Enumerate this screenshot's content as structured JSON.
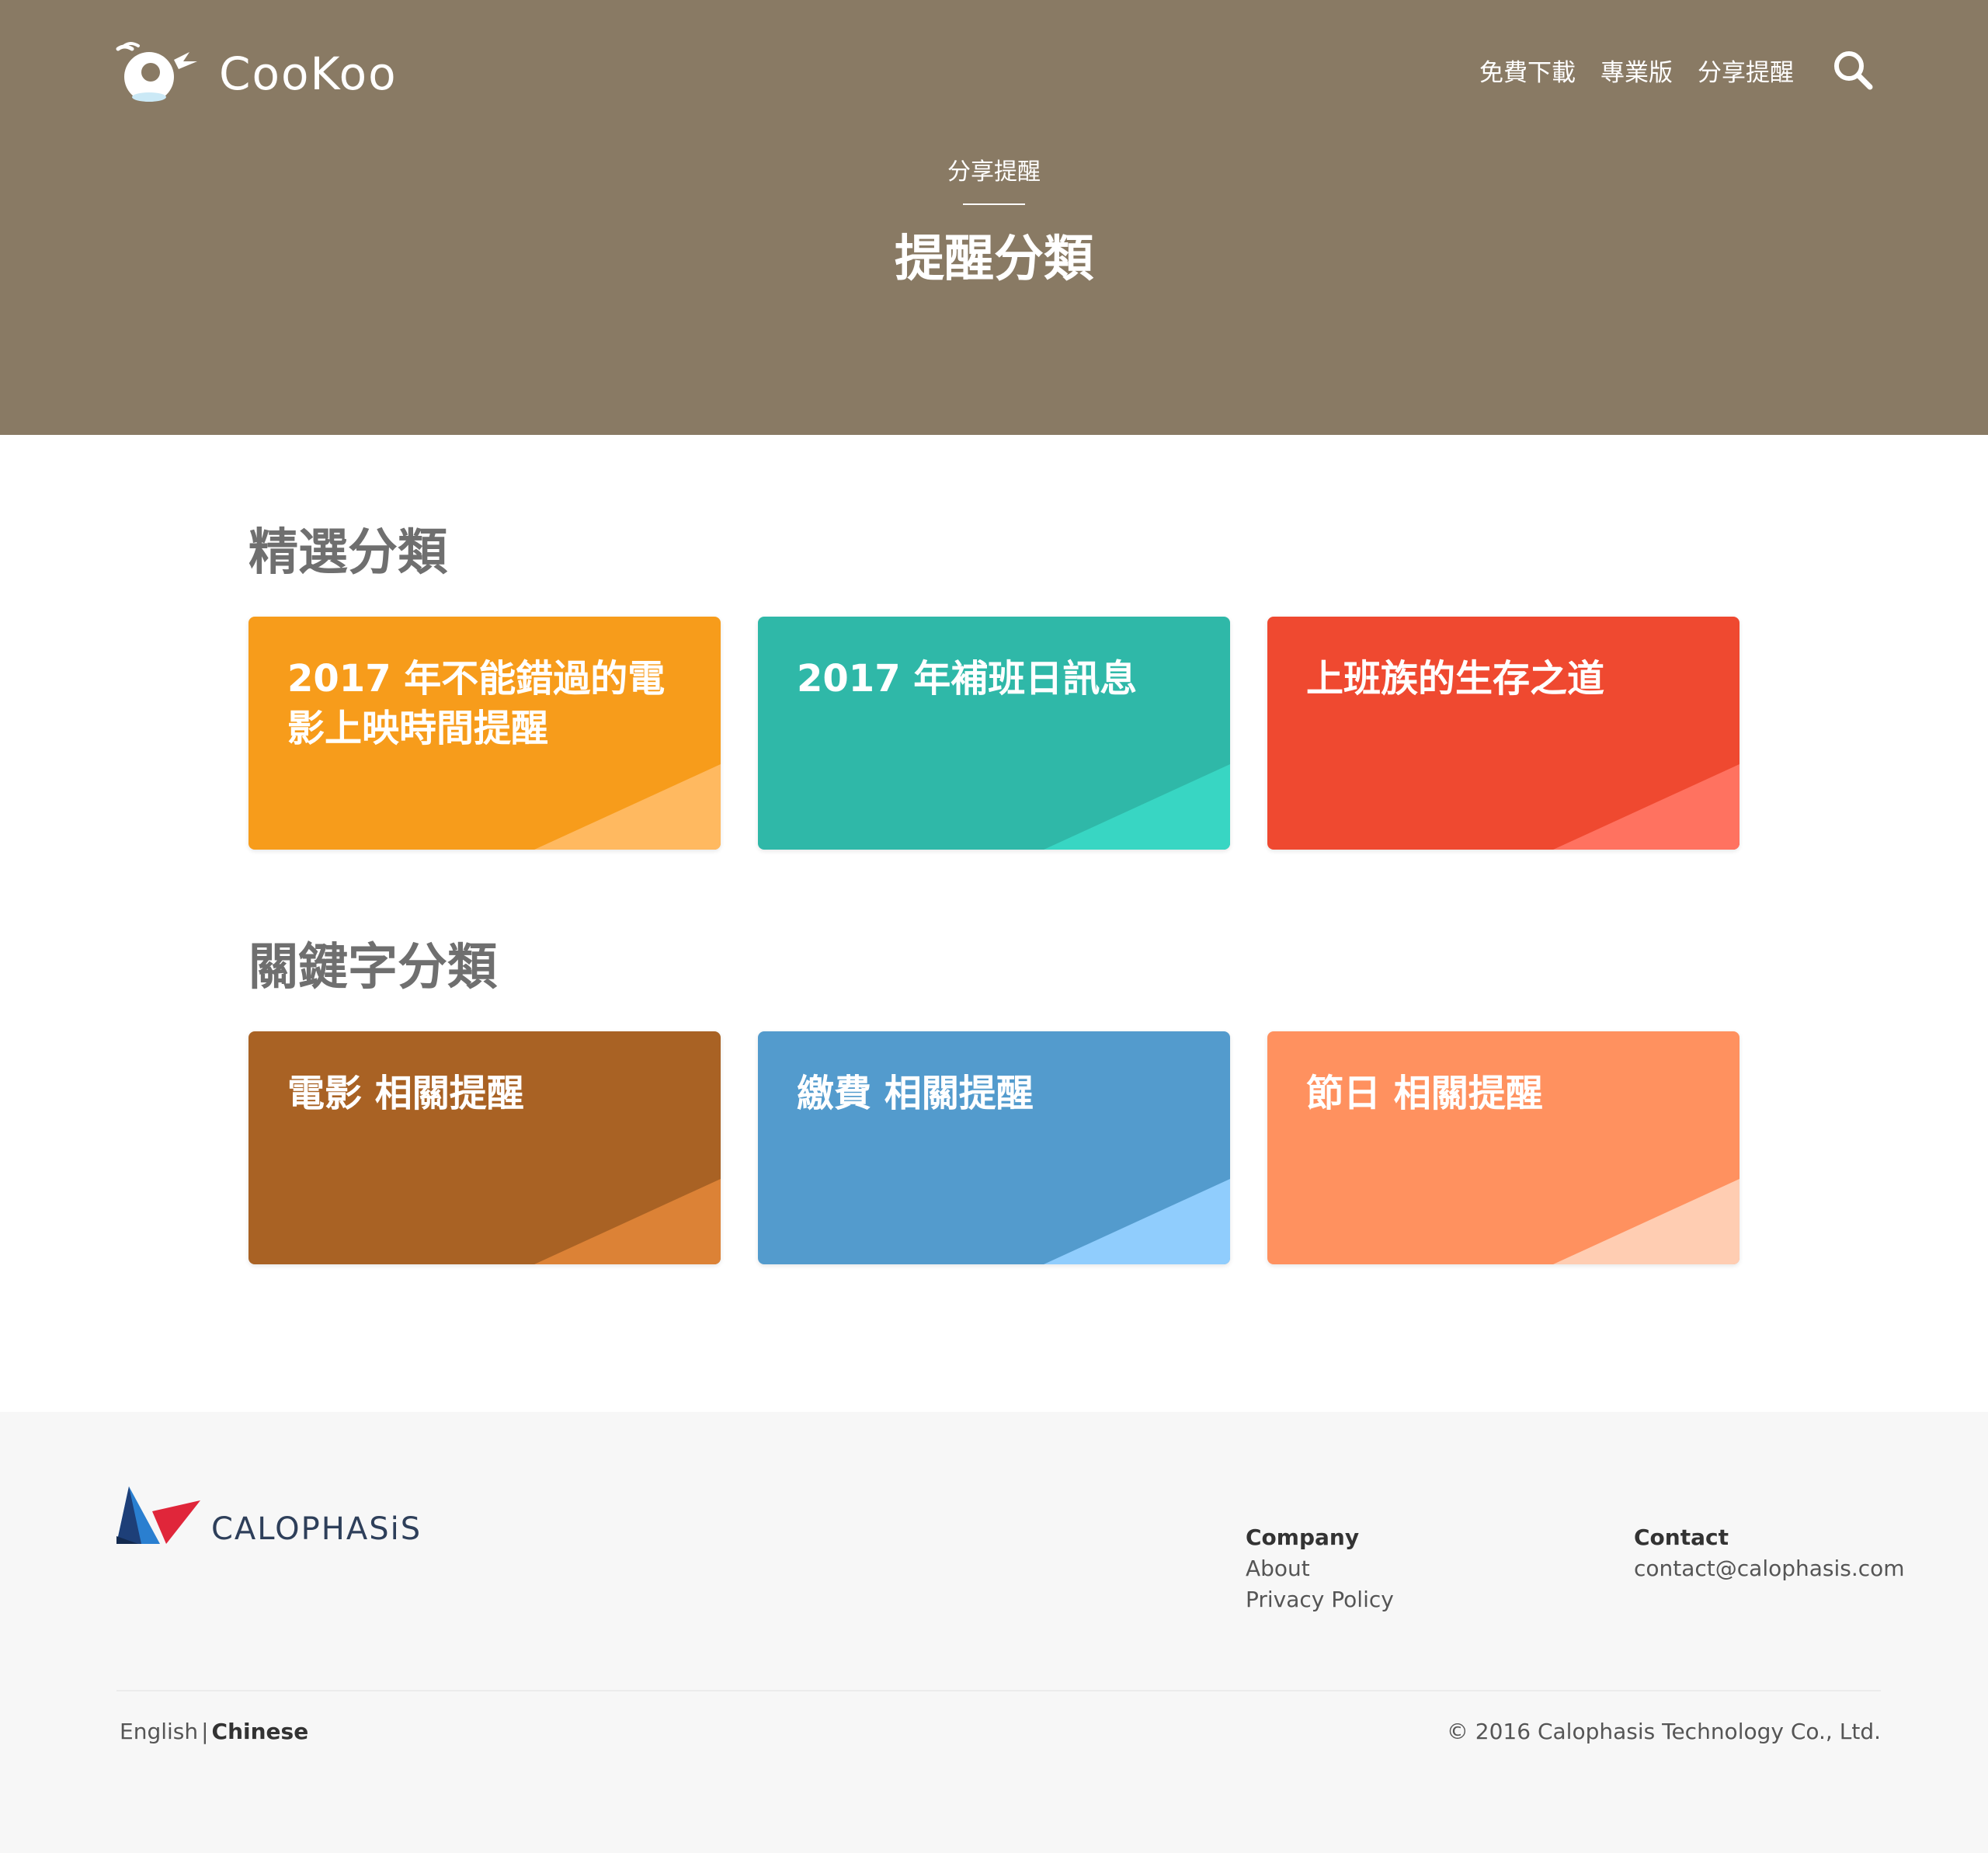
{
  "header": {
    "brand": "CooKoo",
    "nav": [
      "免費下載",
      "專業版",
      "分享提醒"
    ],
    "subtitle": "分享提醒",
    "title": "提醒分類",
    "background": "#897a64"
  },
  "featured": {
    "heading": "精選分類",
    "cards": [
      {
        "title": "2017 年不能錯過的電影上映時間提醒",
        "color": "#f79c1b",
        "accent": "#ffb960"
      },
      {
        "title": "2017 年補班日訊息",
        "color": "#2fb8a8",
        "accent": "#38d6c3"
      },
      {
        "title": "上班族的生存之道",
        "color": "#ef4930",
        "accent": "#ff7260"
      }
    ]
  },
  "keywords": {
    "heading": "關鍵字分類",
    "cards": [
      {
        "title": "電影 相關提醒",
        "color": "#a96224",
        "accent": "#dc8236"
      },
      {
        "title": "繳費 相關提醒",
        "color": "#539bcd",
        "accent": "#90cdfd"
      },
      {
        "title": "節日 相關提醒",
        "color": "#ff915f",
        "accent": "#ffcdb2"
      }
    ]
  },
  "footer": {
    "company_logo": "CALOPHASiS",
    "company": {
      "heading": "Company",
      "links": [
        "About",
        "Privacy Policy"
      ]
    },
    "contact": {
      "heading": "Contact",
      "email": "contact@calophasis.com"
    },
    "languages": {
      "english": "English",
      "separator": "|",
      "chinese": "Chinese"
    },
    "copyright": "© 2016 Calophasis Technology Co., Ltd."
  }
}
